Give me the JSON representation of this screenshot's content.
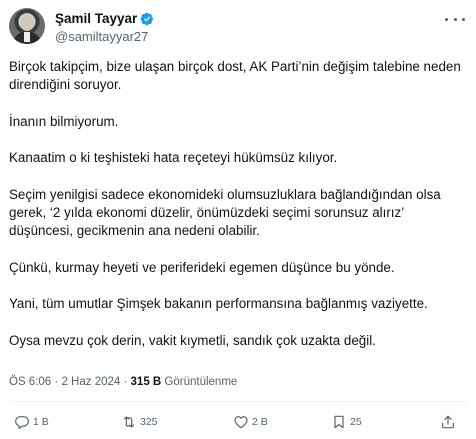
{
  "author": {
    "display_name": "Şamil Tayyar",
    "handle": "@samiltayyar27",
    "verified_color": "#1d9bf0"
  },
  "tweet": {
    "paragraphs": [
      "Birçok takipçim, bize ulaşan birçok dost, AK Parti’nin değişim talebine neden direndiğini soruyor.",
      "İnanın bilmiyorum.",
      "Kanaatim o ki teşhisteki hata reçeteyi hükümsüz kılıyor.",
      "Seçim yenilgisi sadece ekonomideki olumsuzluklara bağlandığından olsa gerek, ‘2 yılda ekonomi düzelir, önümüzdeki seçimi sorunsuz alırız’ düşüncesi, gecikmenin ana nedeni olabilir.",
      "Çünkü, kurmay heyeti ve periferideki egemen düşünce bu yönde.",
      "Yani, tüm umutlar Şimşek bakanın performansına bağlanmış vaziyette.",
      "Oysa mevzu çok derin, vakit kıymetli, sandık çok uzakta değil."
    ]
  },
  "meta": {
    "time": "ÖS 6:06",
    "separator": "·",
    "date": "2 Haz 2024",
    "views_count": "315 B",
    "views_label": "Görüntülenme"
  },
  "actions": {
    "reply_count": "1 B",
    "retweet_count": "325",
    "like_count": "2 B",
    "bookmark_count": "25"
  },
  "icons": {
    "more": "more-horizontal-icon",
    "verified": "verified-badge-icon",
    "reply": "reply-icon",
    "retweet": "retweet-icon",
    "like": "heart-icon",
    "bookmark": "bookmark-icon",
    "share": "share-icon"
  }
}
